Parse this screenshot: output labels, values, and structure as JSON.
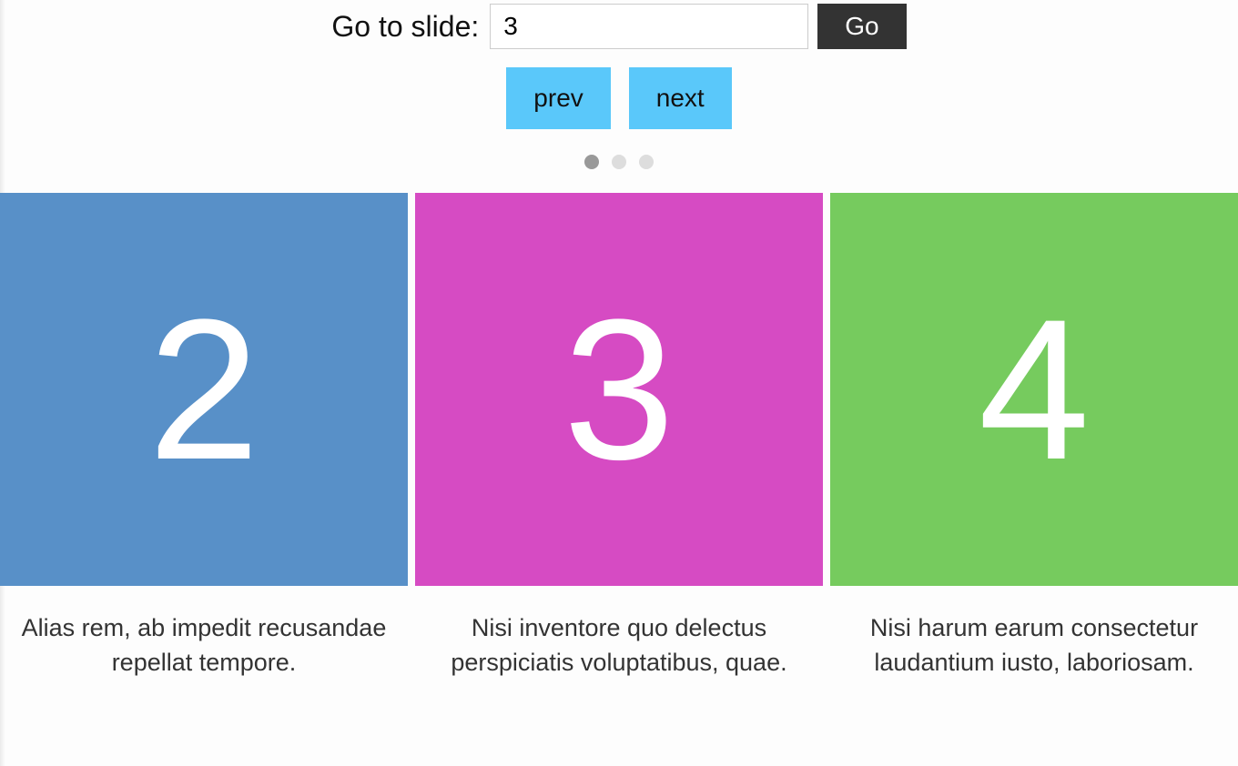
{
  "controls": {
    "goto_label": "Go to slide:",
    "goto_value": "3",
    "go_label": "Go",
    "prev_label": "prev",
    "next_label": "next"
  },
  "dots": {
    "count": 3,
    "active_index": 0
  },
  "slides": [
    {
      "number": "2",
      "bg": "#5890c8",
      "caption": "Alias rem, ab impedit recusandae repellat tempore."
    },
    {
      "number": "3",
      "bg": "#d64bc3",
      "caption": "Nisi inventore quo delectus perspiciatis voluptatibus, quae."
    },
    {
      "number": "4",
      "bg": "#76cb5e",
      "caption": "Nisi harum earum consectetur laudantium iusto, laboriosam."
    }
  ]
}
